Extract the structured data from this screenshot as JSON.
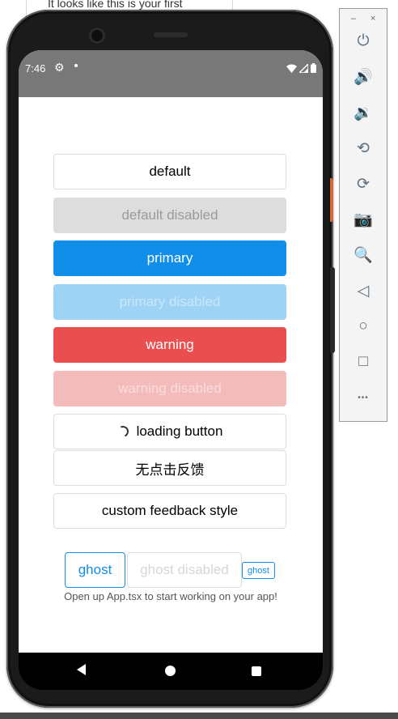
{
  "background": {
    "doc_text": "It looks like this is your first"
  },
  "status_bar": {
    "time": "7:46"
  },
  "buttons": {
    "default": "default",
    "default_disabled": "default disabled",
    "primary": "primary",
    "primary_disabled": "primary disabled",
    "warning": "warning",
    "warning_disabled": "warning disabled",
    "loading": "loading button",
    "no_feedback": "无点击反馈",
    "custom_feedback": "custom feedback style"
  },
  "ghost_buttons": {
    "ghost": "ghost",
    "ghost_disabled": "ghost disabled",
    "ghost_small": "ghost"
  },
  "footer": {
    "text": "Open up App.tsx to start working on your app!"
  },
  "emulator_toolbar": {
    "minimize": "–",
    "close": "×",
    "items": [
      {
        "name": "power-icon",
        "glyph": "⏻"
      },
      {
        "name": "volume-up-icon",
        "glyph": "🔊"
      },
      {
        "name": "volume-down-icon",
        "glyph": "🔉"
      },
      {
        "name": "rotate-left-icon",
        "glyph": "⟲"
      },
      {
        "name": "rotate-right-icon",
        "glyph": "⟳"
      },
      {
        "name": "camera-icon",
        "glyph": "📷"
      },
      {
        "name": "zoom-icon",
        "glyph": "🔍"
      },
      {
        "name": "back-icon",
        "glyph": "◁"
      },
      {
        "name": "home-icon",
        "glyph": "○"
      },
      {
        "name": "overview-icon",
        "glyph": "□"
      },
      {
        "name": "more-icon",
        "glyph": "•••"
      }
    ]
  },
  "colors": {
    "primary": "#108ee9",
    "warning": "#e94f4f",
    "status_bar": "#787878"
  }
}
